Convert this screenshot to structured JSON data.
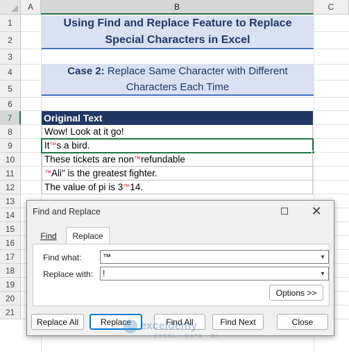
{
  "columns": [
    "A",
    "B",
    "C"
  ],
  "rows": [
    "1",
    "2",
    "3",
    "4",
    "5",
    "6",
    "7",
    "8",
    "9",
    "10",
    "11",
    "12",
    "13",
    "14",
    "15",
    "16",
    "17",
    "18",
    "19",
    "20",
    "21"
  ],
  "title": {
    "line1": "Using Find and Replace Feature to Replace",
    "line2": "Special Characters in Excel"
  },
  "case": {
    "prefix": "Case 2:",
    "line1_rest": " Replace Same Character with Different",
    "line2": "Characters Each Time"
  },
  "table": {
    "header": "Original Text",
    "rows": [
      {
        "before": "Wow! Look at it go!",
        "mark": "",
        "after": ""
      },
      {
        "before": "It",
        "mark": "™",
        "after": "s a bird."
      },
      {
        "before": "These tickets are non",
        "mark": "™",
        "after": "refundable"
      },
      {
        "before": "",
        "mark": "™",
        "after": "Ali\" is the greatest fighter."
      },
      {
        "before": "The value of pi is 3",
        "mark": "™",
        "after": "14."
      }
    ]
  },
  "dialog": {
    "title": "Find and Replace",
    "tabs": {
      "find": "Find",
      "replace": "Replace"
    },
    "find_label": "Find what:",
    "find_value": "™",
    "replace_label": "Replace with:",
    "replace_value": "!",
    "options_button": "Options >>",
    "buttons": {
      "replace_all": "Replace All",
      "replace": "Replace",
      "find_all": "Find All",
      "find_next": "Find Next",
      "close": "Close"
    }
  },
  "watermark": {
    "name": "exceldemy",
    "tagline": "EXCEL · DATA · BI"
  },
  "colors": {
    "excel_green": "#217346",
    "header_fill": "#203764",
    "title_fill": "#d9e1f2",
    "tm_red": "#e0202a"
  }
}
